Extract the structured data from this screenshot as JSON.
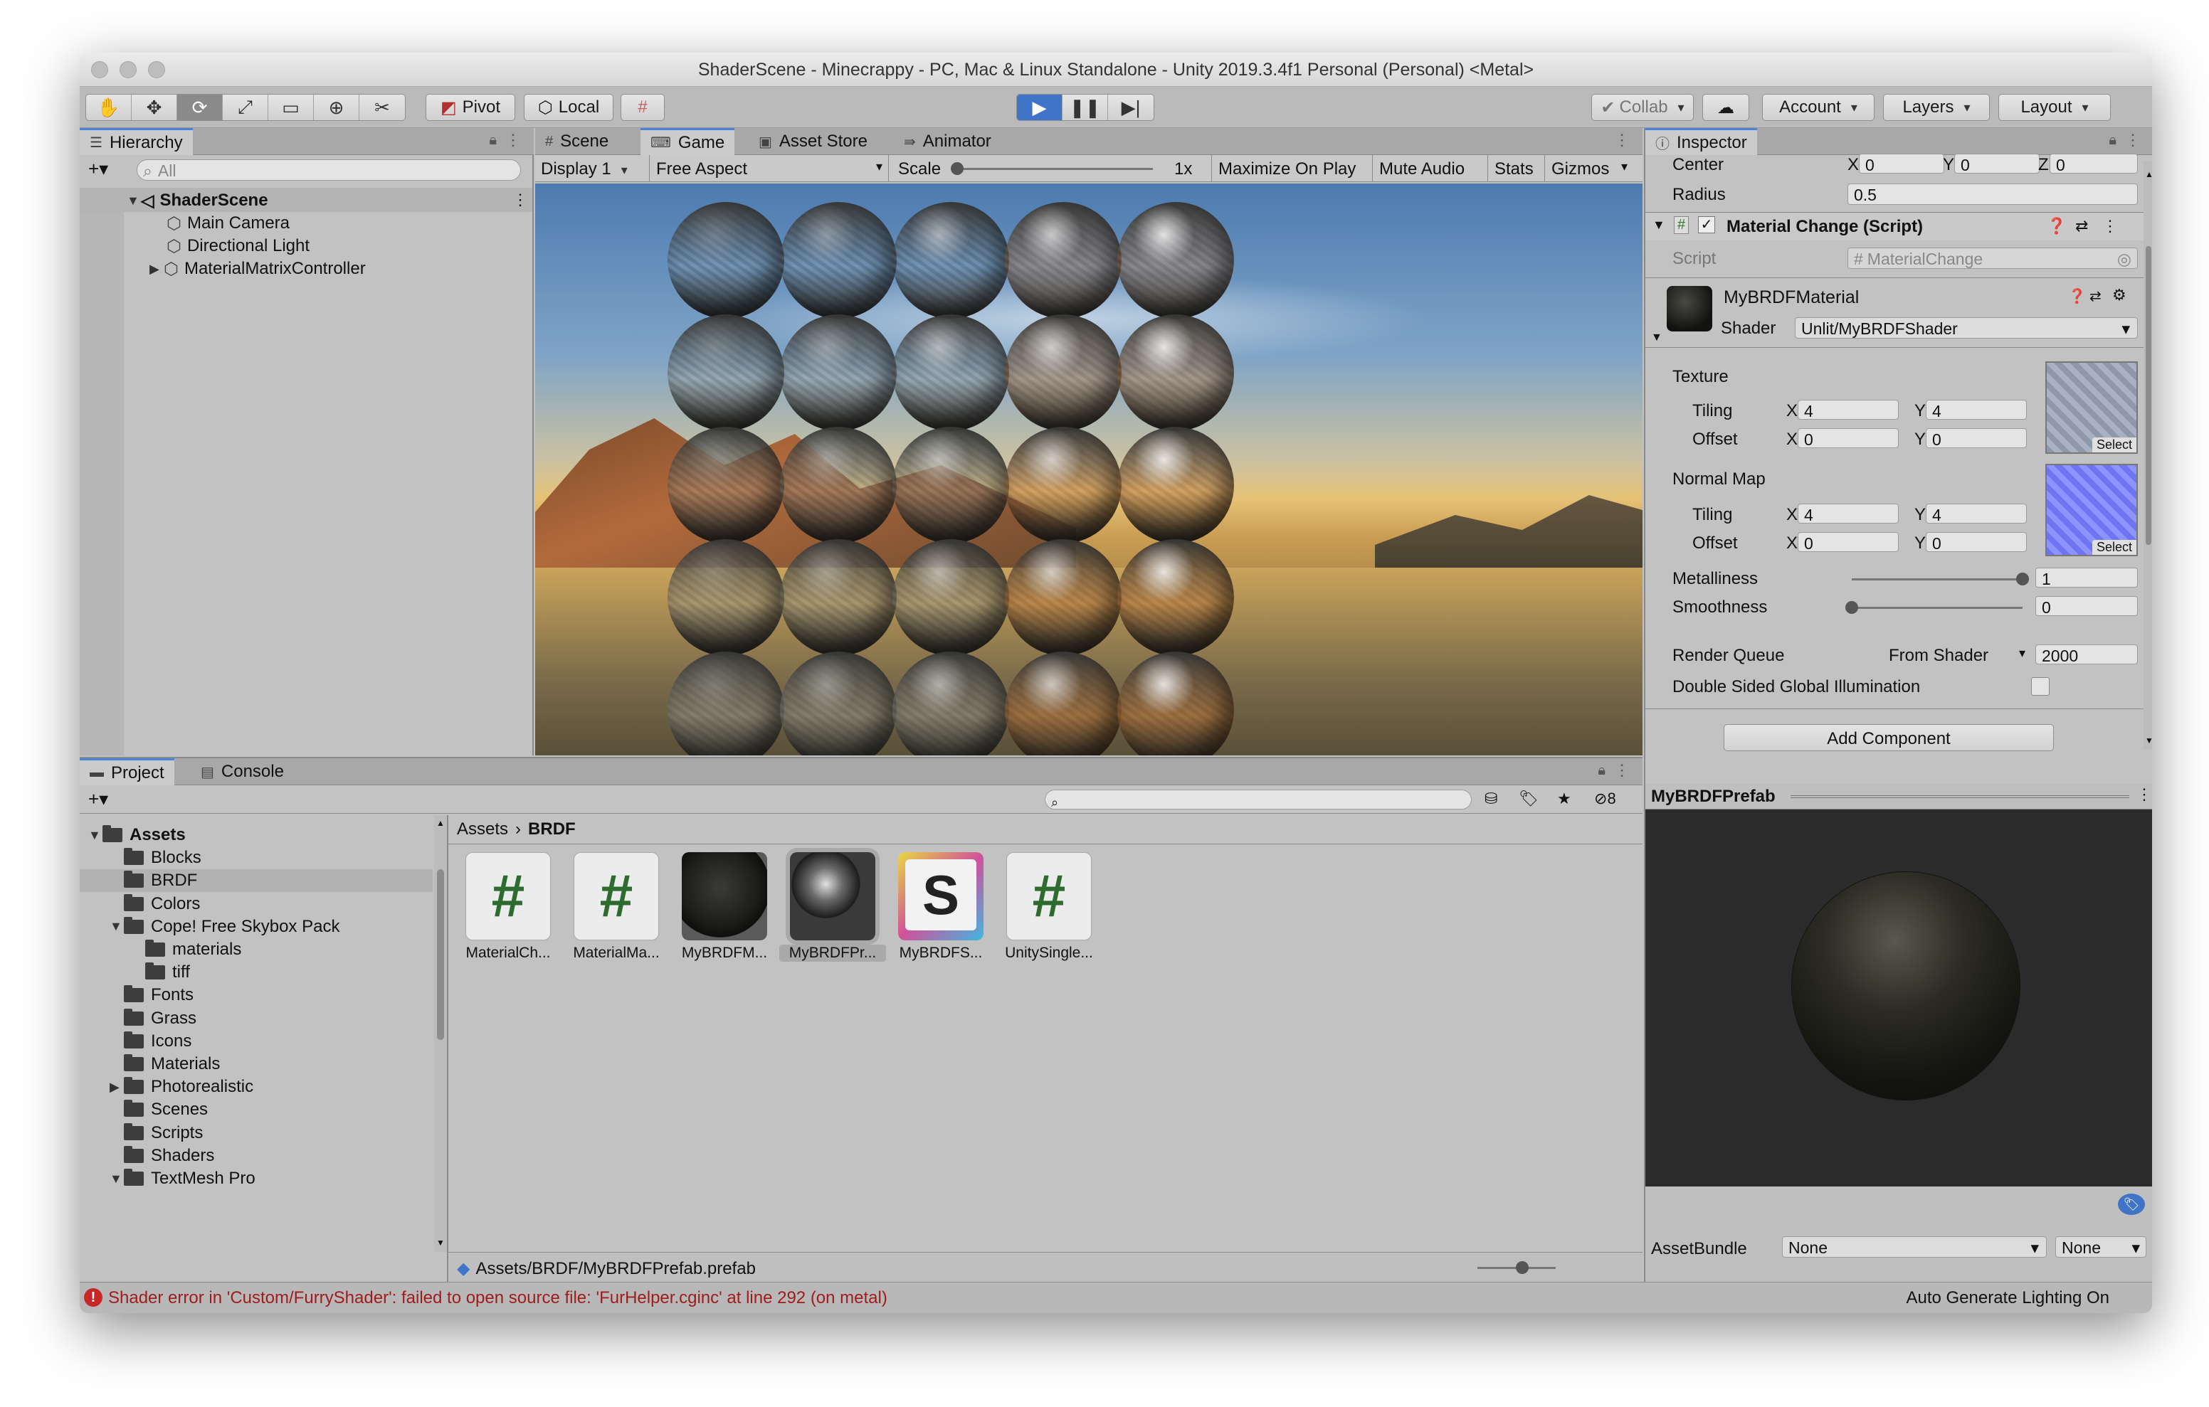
{
  "window": {
    "title": "ShaderScene - Minecrappy - PC, Mac & Linux Standalone - Unity 2019.3.4f1 Personal (Personal) <Metal>"
  },
  "toolbar": {
    "pivot": "Pivot",
    "local": "Local",
    "collab": "Collab",
    "account": "Account",
    "layers": "Layers",
    "layout": "Layout"
  },
  "hierarchy": {
    "tab": "Hierarchy",
    "search_placeholder": "All",
    "scene": "ShaderScene",
    "items": [
      "Main Camera",
      "Directional Light",
      "MaterialMatrixController"
    ]
  },
  "view_tabs": {
    "scene": "Scene",
    "game": "Game",
    "asset_store": "Asset Store",
    "animator": "Animator"
  },
  "game_bar": {
    "display": "Display 1",
    "aspect": "Free Aspect",
    "scale_label": "Scale",
    "scale_value": "1x",
    "maximize": "Maximize On Play",
    "mute": "Mute Audio",
    "stats": "Stats",
    "gizmos": "Gizmos"
  },
  "inspector": {
    "tab": "Inspector",
    "center_label": "Center",
    "center": {
      "x": "0",
      "y": "0",
      "z": "0"
    },
    "radius_label": "Radius",
    "radius": "0.5",
    "component": "Material Change (Script)",
    "script_label": "Script",
    "script_value": "MaterialChange",
    "material_name": "MyBRDFMaterial",
    "shader_label": "Shader",
    "shader_value": "Unlit/MyBRDFShader",
    "texture_label": "Texture",
    "tiling_label": "Tiling",
    "offset_label": "Offset",
    "texture_tiling": {
      "x": "4",
      "y": "4"
    },
    "texture_offset": {
      "x": "0",
      "y": "0"
    },
    "normal_map_label": "Normal Map",
    "normal_tiling": {
      "x": "4",
      "y": "4"
    },
    "normal_offset": {
      "x": "0",
      "y": "0"
    },
    "select": "Select",
    "metalliness_label": "Metalliness",
    "metalliness": "1",
    "smoothness_label": "Smoothness",
    "smoothness": "0",
    "render_queue_label": "Render Queue",
    "render_queue_mode": "From Shader",
    "render_queue": "2000",
    "double_sided_label": "Double Sided Global Illumination",
    "add_component": "Add Component",
    "preview_title": "MyBRDFPrefab",
    "assetbundle_label": "AssetBundle",
    "assetbundle_value": "None",
    "assetbundle_variant": "None",
    "xyz": {
      "x": "X",
      "y": "Y",
      "z": "Z"
    }
  },
  "project": {
    "tab": "Project",
    "console_tab": "Console",
    "hidden_count": "8",
    "breadcrumb_root": "Assets",
    "breadcrumb_current": "BRDF",
    "tree": [
      {
        "label": "Assets",
        "depth": 0,
        "arrow": "▼",
        "bold": true
      },
      {
        "label": "Blocks",
        "depth": 1,
        "arrow": ""
      },
      {
        "label": "BRDF",
        "depth": 1,
        "arrow": "",
        "selected": true
      },
      {
        "label": "Colors",
        "depth": 1,
        "arrow": ""
      },
      {
        "label": "Cope! Free Skybox Pack",
        "depth": 1,
        "arrow": "▼"
      },
      {
        "label": "materials",
        "depth": 2,
        "arrow": ""
      },
      {
        "label": "tiff",
        "depth": 2,
        "arrow": ""
      },
      {
        "label": "Fonts",
        "depth": 1,
        "arrow": ""
      },
      {
        "label": "Grass",
        "depth": 1,
        "arrow": ""
      },
      {
        "label": "Icons",
        "depth": 1,
        "arrow": ""
      },
      {
        "label": "Materials",
        "depth": 1,
        "arrow": ""
      },
      {
        "label": "Photorealistic",
        "depth": 1,
        "arrow": "▶"
      },
      {
        "label": "Scenes",
        "depth": 1,
        "arrow": ""
      },
      {
        "label": "Scripts",
        "depth": 1,
        "arrow": ""
      },
      {
        "label": "Shaders",
        "depth": 1,
        "arrow": ""
      },
      {
        "label": "TextMesh Pro",
        "depth": 1,
        "arrow": "▼"
      }
    ],
    "assets": [
      {
        "label": "MaterialCh...",
        "kind": "script"
      },
      {
        "label": "MaterialMa...",
        "kind": "script"
      },
      {
        "label": "MyBRDFM...",
        "kind": "material"
      },
      {
        "label": "MyBRDFPr...",
        "kind": "prefab",
        "selected": true
      },
      {
        "label": "MyBRDFS...",
        "kind": "shader"
      },
      {
        "label": "UnitySingle...",
        "kind": "script"
      }
    ],
    "selected_path": "Assets/BRDF/MyBRDFPrefab.prefab"
  },
  "status": {
    "error": "Shader error in 'Custom/FurryShader': failed to open source file: 'FurHelper.cginc' at line 292 (on metal)",
    "lighting": "Auto Generate Lighting On"
  },
  "colors": {
    "accent": "#4a84d8",
    "error": "#b32222"
  }
}
